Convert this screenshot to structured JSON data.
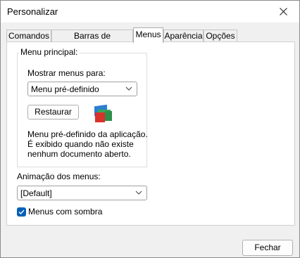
{
  "window": {
    "title": "Personalizar"
  },
  "tabs": [
    {
      "label": "Comandos",
      "active": false
    },
    {
      "label": "Barras de ferramentas",
      "active": false
    },
    {
      "label": "Menus",
      "active": true
    },
    {
      "label": "Aparência",
      "active": false
    },
    {
      "label": "Opções",
      "active": false
    }
  ],
  "menu_group": {
    "legend": "Menu principal:",
    "show_for_label": "Mostrar menus para:",
    "show_for_value": "Menu pré-definido",
    "restore_label": "Restaurar",
    "description": [
      "Menu pré-definido da aplicação.",
      "É exibido quando não existe",
      "nenhum documento aberto."
    ]
  },
  "animation": {
    "label": "Animação dos menus:",
    "value": "[Default]"
  },
  "shadow": {
    "label": "Menus com sombra",
    "checked": true
  },
  "footer": {
    "close_label": "Fechar"
  },
  "icons": {
    "close": "close-icon",
    "app": "application-icon",
    "dropdown": "chevron-down-icon",
    "check": "checkmark-icon"
  },
  "colors": {
    "accent": "#005fb8",
    "icon_red": "#d9312b",
    "icon_green": "#3aa55a",
    "icon_blue": "#2c7fd0"
  }
}
